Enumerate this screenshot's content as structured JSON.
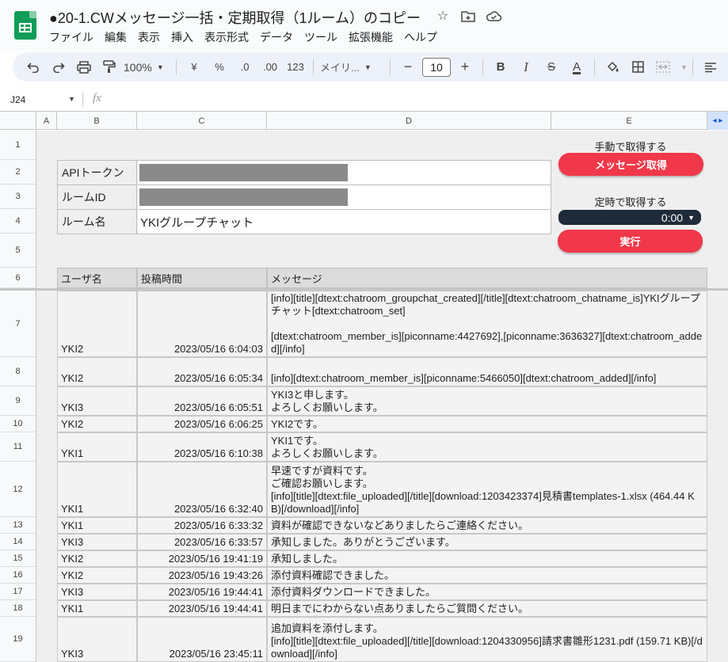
{
  "doc_title": "●20-1.CWメッセージ一括・定期取得（1ルーム）のコピー",
  "menu": [
    "ファイル",
    "編集",
    "表示",
    "挿入",
    "表示形式",
    "データ",
    "ツール",
    "拡張機能",
    "ヘルプ"
  ],
  "toolbar": {
    "zoom": "100%",
    "currency": "¥",
    "percent": "%",
    "dec_less": ".0",
    "dec_more": ".00",
    "number_fmt": "123",
    "font": "メイリ...",
    "font_size": "10"
  },
  "name_box": "J24",
  "fx": "fx",
  "columns": [
    "A",
    "B",
    "C",
    "D",
    "E"
  ],
  "rows": [
    "1",
    "2",
    "3",
    "4",
    "5",
    "6",
    "7",
    "8",
    "9",
    "10",
    "11",
    "12",
    "13",
    "14",
    "15",
    "16",
    "17",
    "18",
    "19"
  ],
  "settings": {
    "api_token_label": "APIトークン",
    "room_id_label": "ルームID",
    "room_name_label": "ルーム名",
    "room_name_value": "YKIグループチャット"
  },
  "controls": {
    "manual_label": "手動で取得する",
    "fetch_button": "メッセージ取得",
    "scheduled_label": "定時で取得する",
    "time_value": "0:00",
    "run_button": "実行"
  },
  "table": {
    "headers": [
      "ユーザ名",
      "投稿時間",
      "メッセージ"
    ],
    "rows": [
      {
        "user": "YKI2",
        "time": "2023/05/16 6:04:03",
        "msg": "[info][title][dtext:chatroom_groupchat_created][/title][dtext:chatroom_chatname_is]YKIグループチャット[dtext:chatroom_set]\n\n[dtext:chatroom_member_is][piconname:4427692],[piconname:3636327][dtext:chatroom_added][/info]"
      },
      {
        "user": "YKI2",
        "time": "2023/05/16 6:05:34",
        "msg": "[info][dtext:chatroom_member_is][piconname:5466050][dtext:chatroom_added][/info]"
      },
      {
        "user": "YKI3",
        "time": "2023/05/16 6:05:51",
        "msg": "YKI3と申します。\nよろしくお願いします。"
      },
      {
        "user": "YKI2",
        "time": "2023/05/16 6:06:25",
        "msg": "YKI2です。"
      },
      {
        "user": "YKI1",
        "time": "2023/05/16 6:10:38",
        "msg": "YKI1です。\nよろしくお願いします。"
      },
      {
        "user": "YKI1",
        "time": "2023/05/16 6:32:40",
        "msg": "早速ですが資料です。\nご確認お願いします。\n[info][title][dtext:file_uploaded][/title][download:1203423374]見積書templates-1.xlsx (464.44 KB)[/download][/info]"
      },
      {
        "user": "YKI1",
        "time": "2023/05/16 6:33:32",
        "msg": "資料が確認できないなどありましたらご連絡ください。"
      },
      {
        "user": "YKI3",
        "time": "2023/05/16 6:33:57",
        "msg": "承知しました。ありがとうございます。"
      },
      {
        "user": "YKI2",
        "time": "2023/05/16 19:41:19",
        "msg": "承知しました。"
      },
      {
        "user": "YKI2",
        "time": "2023/05/16 19:43:26",
        "msg": "添付資料確認できました。"
      },
      {
        "user": "YKI3",
        "time": "2023/05/16 19:44:41",
        "msg": "添付資料ダウンロードできました。"
      },
      {
        "user": "YKI1",
        "time": "2023/05/16 19:44:41",
        "msg": "明日までにわからない点ありましたらご質問ください。"
      },
      {
        "user": "YKI3",
        "time": "2023/05/16 23:45:11",
        "msg": "追加資料を添付します。\n[info][title][dtext:file_uploaded][/title][download:1204330956]請求書雛形1231.pdf (159.71 KB)[/download][/info]"
      }
    ]
  },
  "colors": {
    "red_button": "#f0384a",
    "time_bg": "#1f2a3a",
    "sheets_green": "#0f9d58"
  }
}
